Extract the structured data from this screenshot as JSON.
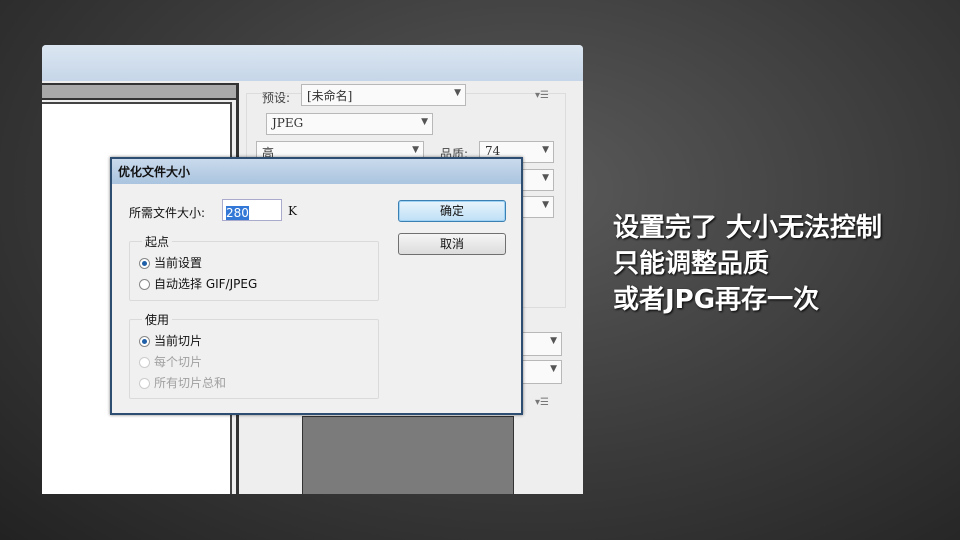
{
  "panel": {
    "preset_label": "预设:",
    "preset_value": "[未命名]",
    "format_value": "JPEG",
    "quality_level": "高",
    "quality_label": "品质:",
    "quality_value": "74"
  },
  "dialog": {
    "title": "优化文件大小",
    "size_label": "所需文件大小:",
    "size_value": "280",
    "size_unit": "K",
    "ok_label": "确定",
    "cancel_label": "取消",
    "start_group": {
      "title": "起点",
      "options": [
        {
          "label": "当前设置",
          "selected": true,
          "enabled": true
        },
        {
          "label": "自动选择 GIF/JPEG",
          "selected": false,
          "enabled": true
        }
      ]
    },
    "use_group": {
      "title": "使用",
      "options": [
        {
          "label": "当前切片",
          "selected": true,
          "enabled": true
        },
        {
          "label": "每个切片",
          "selected": false,
          "enabled": false
        },
        {
          "label": "所有切片总和",
          "selected": false,
          "enabled": false
        }
      ]
    }
  },
  "caption": {
    "lines": [
      "设置完了 大小无法控制",
      "只能调整品质",
      "或者JPG再存一次"
    ]
  }
}
